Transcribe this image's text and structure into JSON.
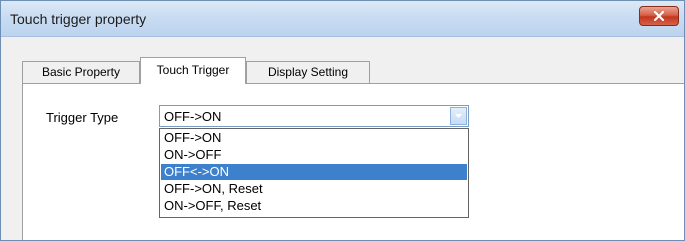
{
  "window": {
    "title": "Touch trigger property",
    "close_icon": "close-icon"
  },
  "tabs": [
    {
      "label": "Basic Property",
      "active": false
    },
    {
      "label": "Touch Trigger",
      "active": true
    },
    {
      "label": "Display Setting",
      "active": false
    }
  ],
  "trigger": {
    "label": "Trigger Type",
    "selected_value": "OFF->ON",
    "options": [
      {
        "label": "OFF->ON",
        "highlighted": false
      },
      {
        "label": "ON->OFF",
        "highlighted": false
      },
      {
        "label": "OFF<->ON",
        "highlighted": true
      },
      {
        "label": "OFF->ON, Reset",
        "highlighted": false
      },
      {
        "label": "ON->OFF, Reset",
        "highlighted": false
      }
    ]
  },
  "colors": {
    "titlebar": "#c9dcf2",
    "close_button": "#c2361d",
    "highlight": "#3d80cc",
    "dialog_bg": "#f0f0f0"
  }
}
